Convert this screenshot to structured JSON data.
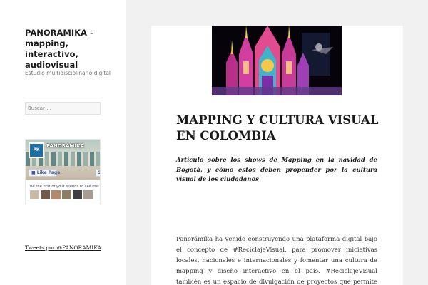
{
  "sidebar": {
    "site_title": "PANORAMIKA – mapping, interactivo, audiovisual",
    "site_description": "Estudio multidisciplinario digital",
    "search_placeholder": "Buscar …",
    "facebook_widget": {
      "page_name": "PANORAMIKA",
      "logo_text": "PK",
      "like_label": "Like Page",
      "share_label": "S",
      "friends_text": "Be the first of your friends to like this"
    },
    "tweets_link": "Tweets por @PANORAMIKA"
  },
  "post": {
    "hero_image": "cathedral-projection-mapping",
    "title": "MAPPING Y CULTURA VISUAL EN COLOMBIA",
    "lead": "Artículo sobre los shows de Mapping en la navidad de Bogotá, y cómo estos deben propender por la cultura visual de los ciudadanos",
    "body": "Panorámika ha venido construyendo una plataforma digital bajo el concepto de #ReciclajeVisual, para promover iniciativas locales, nacionales e internacionales y fomentar una cultura de mapping y diseño interactivo en el país. #ReciclajeVisual también es un espacio de divulgación de proyectos que permite involucrar a los"
  },
  "colors": {
    "page_background": "#f1f1f1",
    "panel_background": "#ffffff",
    "text": "#1a1a1a",
    "facebook_blue": "#3b5998"
  }
}
